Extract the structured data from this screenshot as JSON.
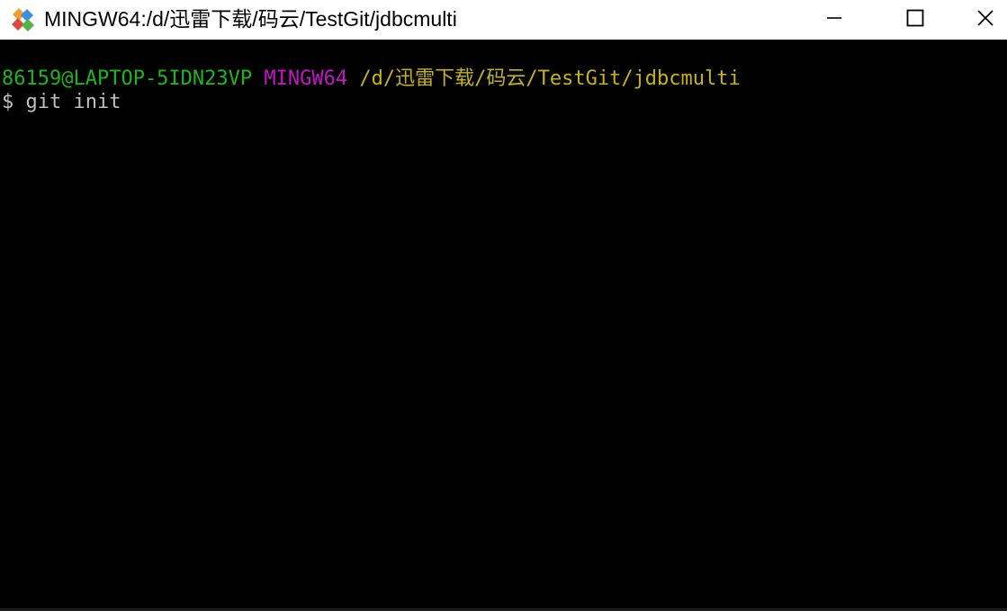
{
  "window": {
    "title": "MINGW64:/d/迅雷下载/码云/TestGit/jdbcmulti",
    "icon": "git-bash-icon",
    "controls": {
      "minimize": "minimize-icon",
      "maximize": "maximize-icon",
      "close": "close-icon"
    }
  },
  "terminal": {
    "prompt": {
      "user_host": "86159@LAPTOP-5IDN23VP",
      "system": "MINGW64",
      "path": "/d/迅雷下载/码云/TestGit/jdbcmulti"
    },
    "command_line": "$ git init"
  },
  "colors": {
    "user_host": "#1cb61c",
    "system": "#c414c4",
    "path": "#c6b21a",
    "command": "#bfbfbf",
    "background": "#000000",
    "titlebar": "#ffffff"
  }
}
